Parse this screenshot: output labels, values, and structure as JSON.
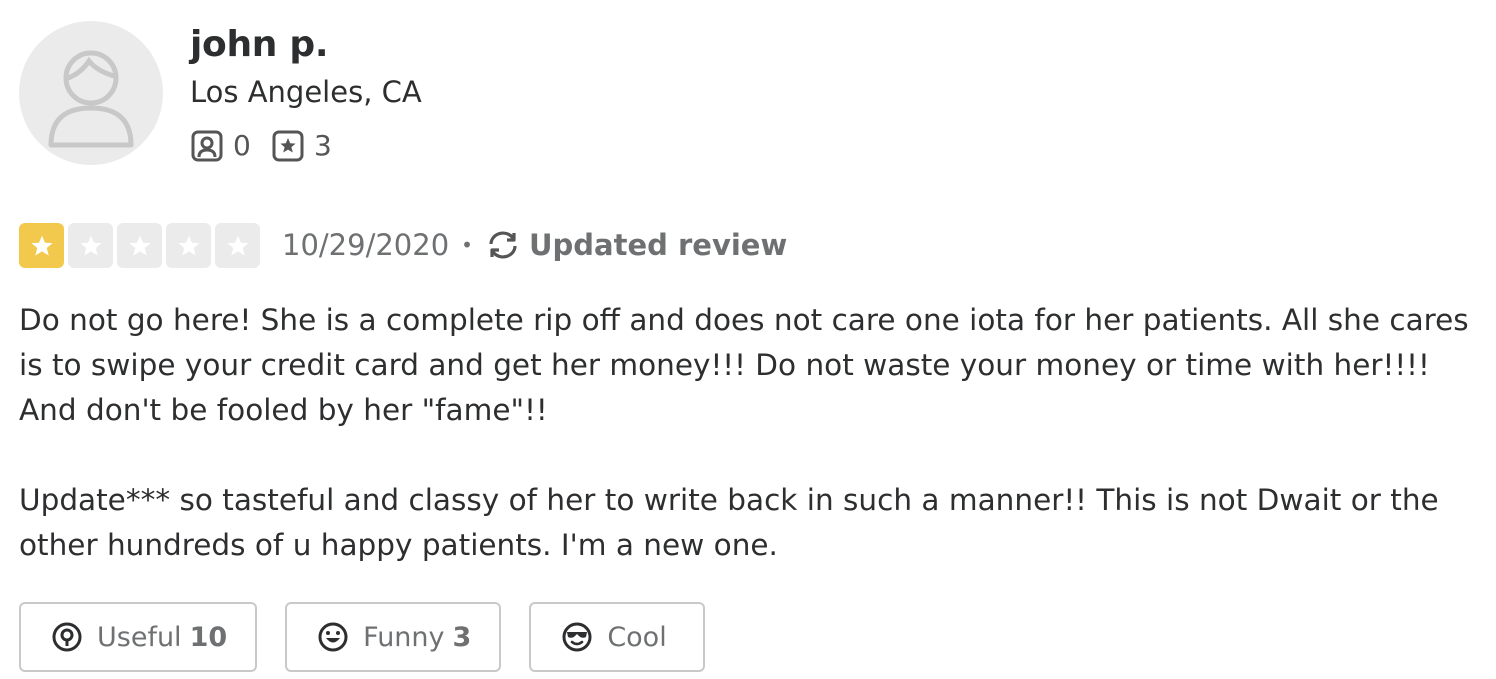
{
  "user": {
    "name": "john p.",
    "location": "Los Angeles, CA",
    "friends_count": "0",
    "reviews_count": "3"
  },
  "review": {
    "rating": 1,
    "rating_max": 5,
    "date": "10/29/2020",
    "separator": "•",
    "updated_label": "Updated review",
    "paragraphs": [
      "Do not go here! She is a complete rip off and does not care one iota for her patients. All she cares is to swipe your credit card and get her money!!! Do not waste your money or time with her!!!! And don't be fooled by her \"fame\"!!",
      "Update*** so tasteful and classy of her to write back in such a manner!! This is not Dwait or the other hundreds of u happy patients. I'm a new one."
    ]
  },
  "reactions": {
    "useful": {
      "label": "Useful",
      "count": "10"
    },
    "funny": {
      "label": "Funny",
      "count": "3"
    },
    "cool": {
      "label": "Cool",
      "count": ""
    }
  },
  "colors": {
    "star_on": "#f2c94c",
    "star_off": "#ebebeb",
    "text": "#2d2e2f",
    "muted": "#6e7072"
  },
  "icons": {
    "avatar": "user-silhouette-icon",
    "friends": "friends-icon",
    "reviews": "review-star-icon",
    "updated": "refresh-icon",
    "useful": "lightbulb-icon",
    "funny": "smile-icon",
    "cool": "sunglasses-icon"
  }
}
